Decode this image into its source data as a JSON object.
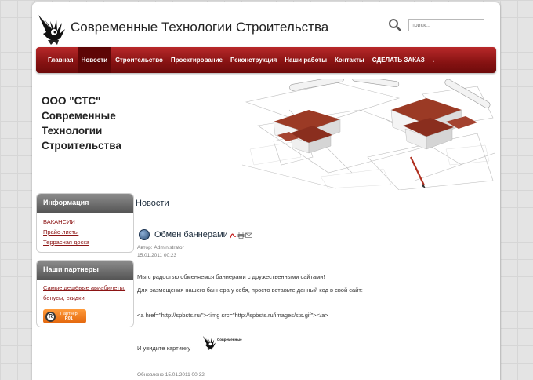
{
  "header": {
    "site_title": "Современные Технологии Строительства",
    "search_placeholder": "поиск..."
  },
  "nav": {
    "items": [
      {
        "label": "Главная"
      },
      {
        "label": "Новости"
      },
      {
        "label": "Строительство"
      },
      {
        "label": "Проектирование"
      },
      {
        "label": "Реконструкция"
      },
      {
        "label": "Наши работы"
      },
      {
        "label": "Контакты"
      },
      {
        "label": "СДЕЛАТЬ ЗАКАЗ"
      },
      {
        "label": "."
      }
    ],
    "active": "Новости"
  },
  "company": {
    "line1": "ООО \"СТС\"",
    "line2": "Современные",
    "line3": "Технологии",
    "line4": "Строительства"
  },
  "sidebar": {
    "info": {
      "title": "Информация",
      "links": [
        {
          "label": "ВАКАНСИИ"
        },
        {
          "label": "Прайс-листы"
        },
        {
          "label": "Террасная доска"
        }
      ]
    },
    "partners": {
      "title": "Наши партнеры",
      "link_line1": "Самые дешёвые авиабилеты,",
      "link_line2": "бонусы, скидки!",
      "badge_letter": "R",
      "badge_line1": "Партнер",
      "badge_line2": "R01"
    }
  },
  "content": {
    "section_title": "Новости",
    "article_title": "Обмен баннерами",
    "author": "Автор: Administrator",
    "date": "15.01.2011 00:23",
    "para1": "Мы с радостью обменяемся баннерами с дружественными сайтами!",
    "para2": "Для размещения нашего баннера у себя, просто вставьте данный код в свой сайт:",
    "code": "<a href=\"http://spbsts.ru/\"><img src=\"http://spbsts.ru/images/sts.gif\"></a>",
    "see_picture": "И увидите картинку",
    "mini_logo_caption": "Современные",
    "updated": "Обновлено 15.01.2011 00:32"
  },
  "colors": {
    "nav_red": "#861212",
    "link_red": "#8c1414",
    "partner_orange": "#e3660c"
  }
}
